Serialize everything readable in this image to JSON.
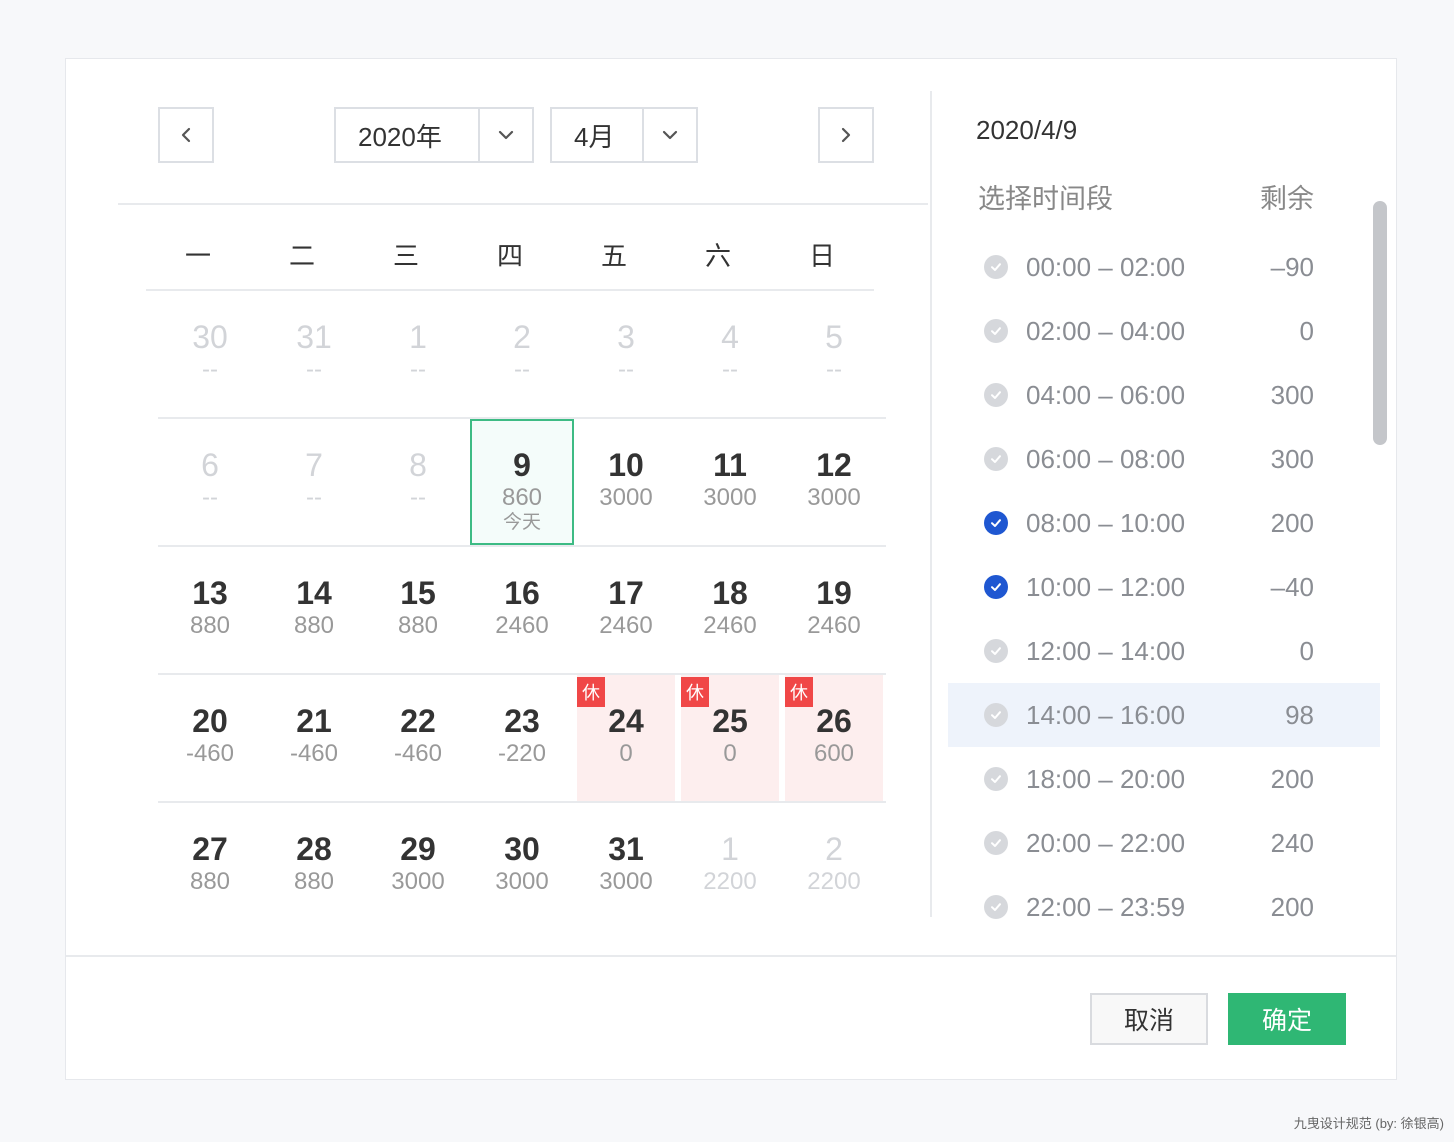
{
  "header": {
    "year_value": "2020年",
    "month_value": "4月"
  },
  "weekdays": [
    "一",
    "二",
    "三",
    "四",
    "五",
    "六",
    "日"
  ],
  "weeks": [
    [
      {
        "day": "30",
        "value": "--",
        "muted": true
      },
      {
        "day": "31",
        "value": "--",
        "muted": true
      },
      {
        "day": "1",
        "value": "--",
        "muted": true
      },
      {
        "day": "2",
        "value": "--",
        "muted": true
      },
      {
        "day": "3",
        "value": "--",
        "muted": true
      },
      {
        "day": "4",
        "value": "--",
        "muted": true
      },
      {
        "day": "5",
        "value": "--",
        "muted": true
      }
    ],
    [
      {
        "day": "6",
        "value": "--",
        "muted": true
      },
      {
        "day": "7",
        "value": "--",
        "muted": true
      },
      {
        "day": "8",
        "value": "--",
        "muted": true
      },
      {
        "day": "9",
        "value": "860",
        "today": true,
        "tag": "今天"
      },
      {
        "day": "10",
        "value": "3000"
      },
      {
        "day": "11",
        "value": "3000"
      },
      {
        "day": "12",
        "value": "3000"
      }
    ],
    [
      {
        "day": "13",
        "value": "880"
      },
      {
        "day": "14",
        "value": "880"
      },
      {
        "day": "15",
        "value": "880"
      },
      {
        "day": "16",
        "value": "2460"
      },
      {
        "day": "17",
        "value": "2460"
      },
      {
        "day": "18",
        "value": "2460"
      },
      {
        "day": "19",
        "value": "2460"
      }
    ],
    [
      {
        "day": "20",
        "value": "-460"
      },
      {
        "day": "21",
        "value": "-460"
      },
      {
        "day": "22",
        "value": "-460"
      },
      {
        "day": "23",
        "value": "-220"
      },
      {
        "day": "24",
        "value": "0",
        "holiday": true,
        "badge": "休"
      },
      {
        "day": "25",
        "value": "0",
        "holiday": true,
        "badge": "休"
      },
      {
        "day": "26",
        "value": "600",
        "holiday": true,
        "badge": "休"
      }
    ],
    [
      {
        "day": "27",
        "value": "880"
      },
      {
        "day": "28",
        "value": "880"
      },
      {
        "day": "29",
        "value": "3000"
      },
      {
        "day": "30",
        "value": "3000"
      },
      {
        "day": "31",
        "value": "3000"
      },
      {
        "day": "1",
        "value": "2200",
        "muted": true
      },
      {
        "day": "2",
        "value": "2200",
        "muted": true
      }
    ]
  ],
  "panel": {
    "selected_date": "2020/4/9",
    "col_time": "选择时间段",
    "col_remain": "剩余",
    "slots": [
      {
        "time": "00:00 – 02:00",
        "remain": "–90",
        "checked": false
      },
      {
        "time": "02:00 – 04:00",
        "remain": "0",
        "checked": false
      },
      {
        "time": "04:00 – 06:00",
        "remain": "300",
        "checked": false
      },
      {
        "time": "06:00 – 08:00",
        "remain": "300",
        "checked": false
      },
      {
        "time": "08:00 – 10:00",
        "remain": "200",
        "checked": true
      },
      {
        "time": "10:00 – 12:00",
        "remain": "–40",
        "checked": true
      },
      {
        "time": "12:00 – 14:00",
        "remain": "0",
        "checked": false
      },
      {
        "time": "14:00 – 16:00",
        "remain": "98",
        "checked": false,
        "hover": true
      },
      {
        "time": "18:00 – 20:00",
        "remain": "200",
        "checked": false
      },
      {
        "time": "20:00 – 22:00",
        "remain": "240",
        "checked": false
      },
      {
        "time": "22:00 – 23:59",
        "remain": "200",
        "checked": false
      }
    ]
  },
  "footer": {
    "cancel_label": "取消",
    "ok_label": "确定"
  },
  "watermark": "九曳设计规范 (by: 徐银高)",
  "colors": {
    "accent_green": "#2fb774",
    "today_border": "#3dbb84",
    "check_blue": "#1f57d1",
    "holiday_red": "#f04747",
    "holiday_bg": "#fdeeee"
  },
  "icons": {
    "prev": "chevron-left-icon",
    "next": "chevron-right-icon",
    "dropdown": "chevron-down-icon",
    "slot_check": "check-circle-icon"
  }
}
